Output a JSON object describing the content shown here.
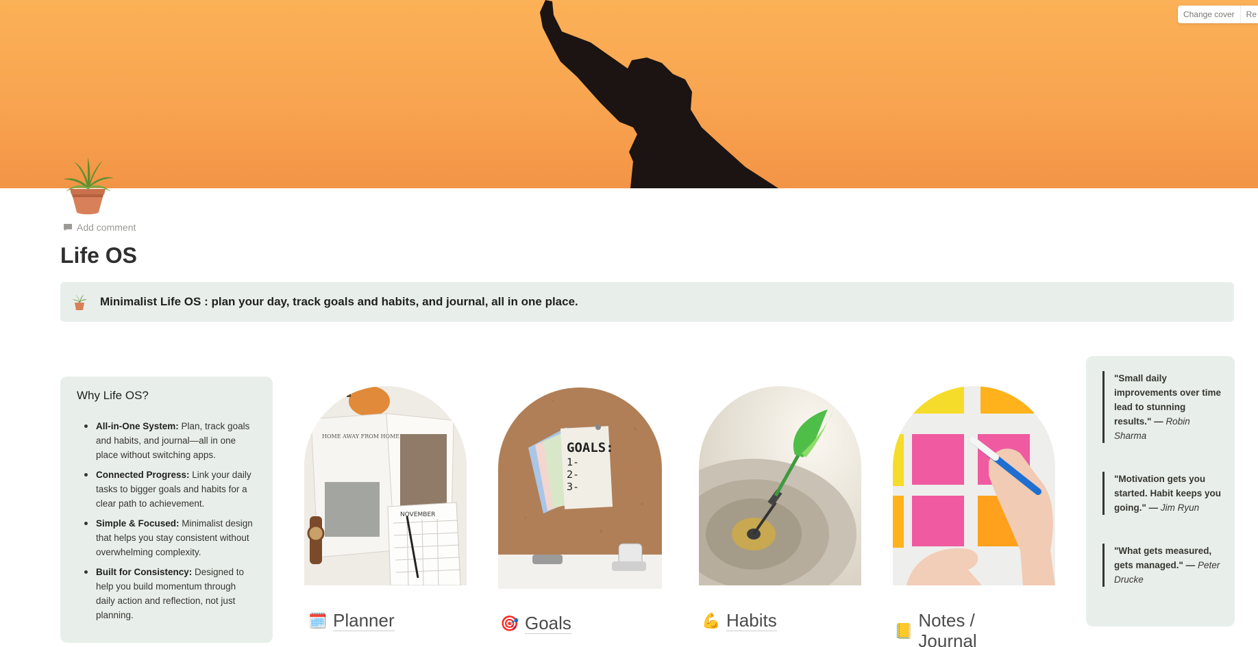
{
  "cover": {
    "change_cover": "Change cover",
    "reposition": "Re"
  },
  "page": {
    "icon": "potted-plant-icon",
    "add_comment": "Add comment",
    "title": "Life OS"
  },
  "callout": {
    "icon": "potted-plant-icon",
    "text": "Minimalist Life OS : plan your day, track goals and habits, and journal, all in one place."
  },
  "why": {
    "title": "Why Life OS?",
    "items": [
      {
        "bold": "All-in-One System:",
        "text": " Plan, track goals and habits, and journal—all in one place without switching apps."
      },
      {
        "bold": "Connected Progress:",
        "text": " Link your daily tasks to bigger goals and habits for a clear path to achievement."
      },
      {
        "bold": "Simple & Focused:",
        "text": " Minimalist design that helps you stay consistent without overwhelming complexity."
      },
      {
        "bold": "Built for Consistency:",
        "text": " Designed to help you build momentum through daily action and reflection, not just planning."
      }
    ]
  },
  "cards": [
    {
      "emoji": "🗓️",
      "icon": "calendar-icon",
      "label": "Planner"
    },
    {
      "emoji": "🎯",
      "icon": "target-icon",
      "label": "Goals"
    },
    {
      "emoji": "💪",
      "icon": "flexed-arm-icon",
      "label": "Habits"
    },
    {
      "emoji": "📒",
      "icon": "notebook-icon",
      "label": "Notes / Journal"
    }
  ],
  "quotes": [
    {
      "text": "\"Small daily improvements over time lead to stunning results.\" — ",
      "author": "Robin Sharma"
    },
    {
      "text": "\"Motivation gets you started. Habit keeps you going.\" — ",
      "author": "Jim Ryun"
    },
    {
      "text": "\"What gets measured, gets managed.\" — ",
      "author": "Peter Drucke"
    }
  ],
  "image_texts": {
    "goals_note_title": "GOALS:",
    "goals_note_lines": [
      "1-",
      "2-",
      "3-"
    ],
    "planner_calendar_month": "NOVEMBER",
    "planner_magazine": "HOME AWAY FROM HOME"
  }
}
